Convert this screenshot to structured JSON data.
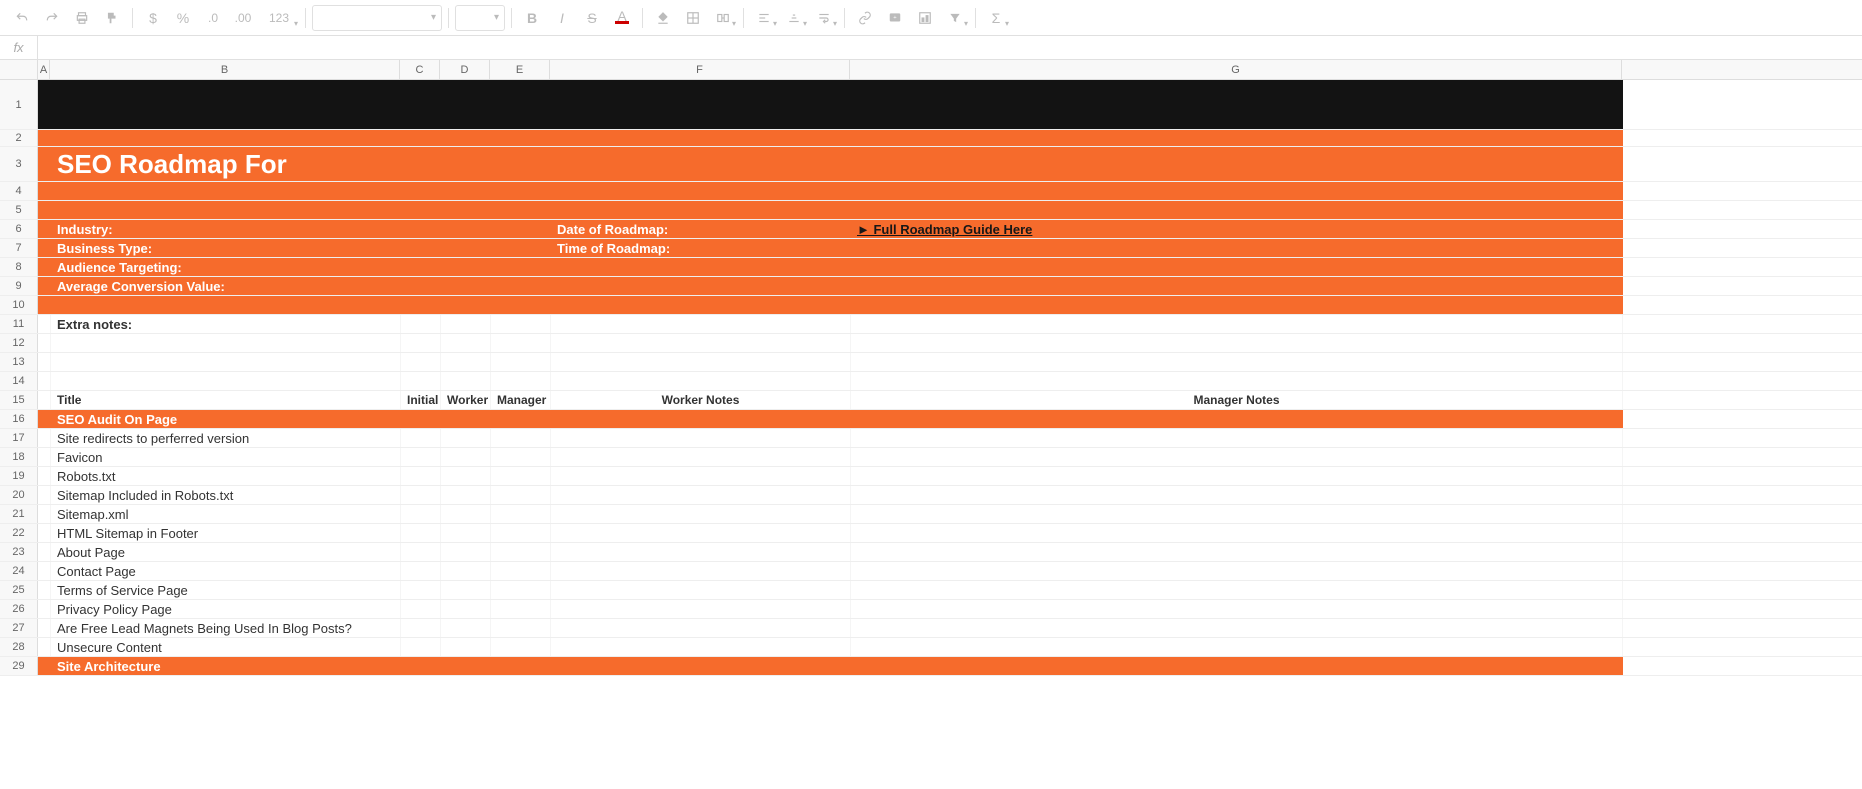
{
  "toolbar": {
    "currency_hint": "$",
    "percent_hint": "%",
    "dec_dec": ".0",
    "dec_inc": ".00",
    "more_formats": "123",
    "bold": "B",
    "italic": "I",
    "sigma": "Σ",
    "textcolor_letter": "A"
  },
  "columns": [
    "A",
    "B",
    "C",
    "D",
    "E",
    "F",
    "G"
  ],
  "row_numbers": [
    1,
    2,
    3,
    4,
    5,
    6,
    7,
    8,
    9,
    10,
    11,
    12,
    13,
    14,
    15,
    16,
    17,
    18,
    19,
    20,
    21,
    22,
    23,
    24,
    25,
    26,
    27,
    28,
    29
  ],
  "banner": {
    "title": "SEO Roadmap For",
    "meta_left": [
      "Industry:",
      "Business Type:",
      "Audience Targeting:",
      "Average Conversion Value:"
    ],
    "meta_right_top": "Date of Roadmap:",
    "meta_right_second": "Time of Roadmap:",
    "link_text": "► Full Roadmap Guide Here"
  },
  "extra_notes_label": "Extra notes:",
  "headers": {
    "title": "Title",
    "initial": "Initial",
    "worker": "Worker",
    "manager": "Manager",
    "worker_notes": "Worker Notes",
    "manager_notes": "Manager Notes"
  },
  "sections": {
    "audit": "SEO Audit On Page",
    "arch": "Site Architecture"
  },
  "audit_items": [
    "Site redirects to perferred version",
    "Favicon",
    "Robots.txt",
    "Sitemap Included in Robots.txt",
    "Sitemap.xml",
    "HTML Sitemap in Footer",
    "About Page",
    "Contact Page",
    "Terms of Service Page",
    "Privacy Policy Page",
    "Are Free Lead Magnets Being Used In Blog Posts?",
    "Unsecure Content"
  ]
}
